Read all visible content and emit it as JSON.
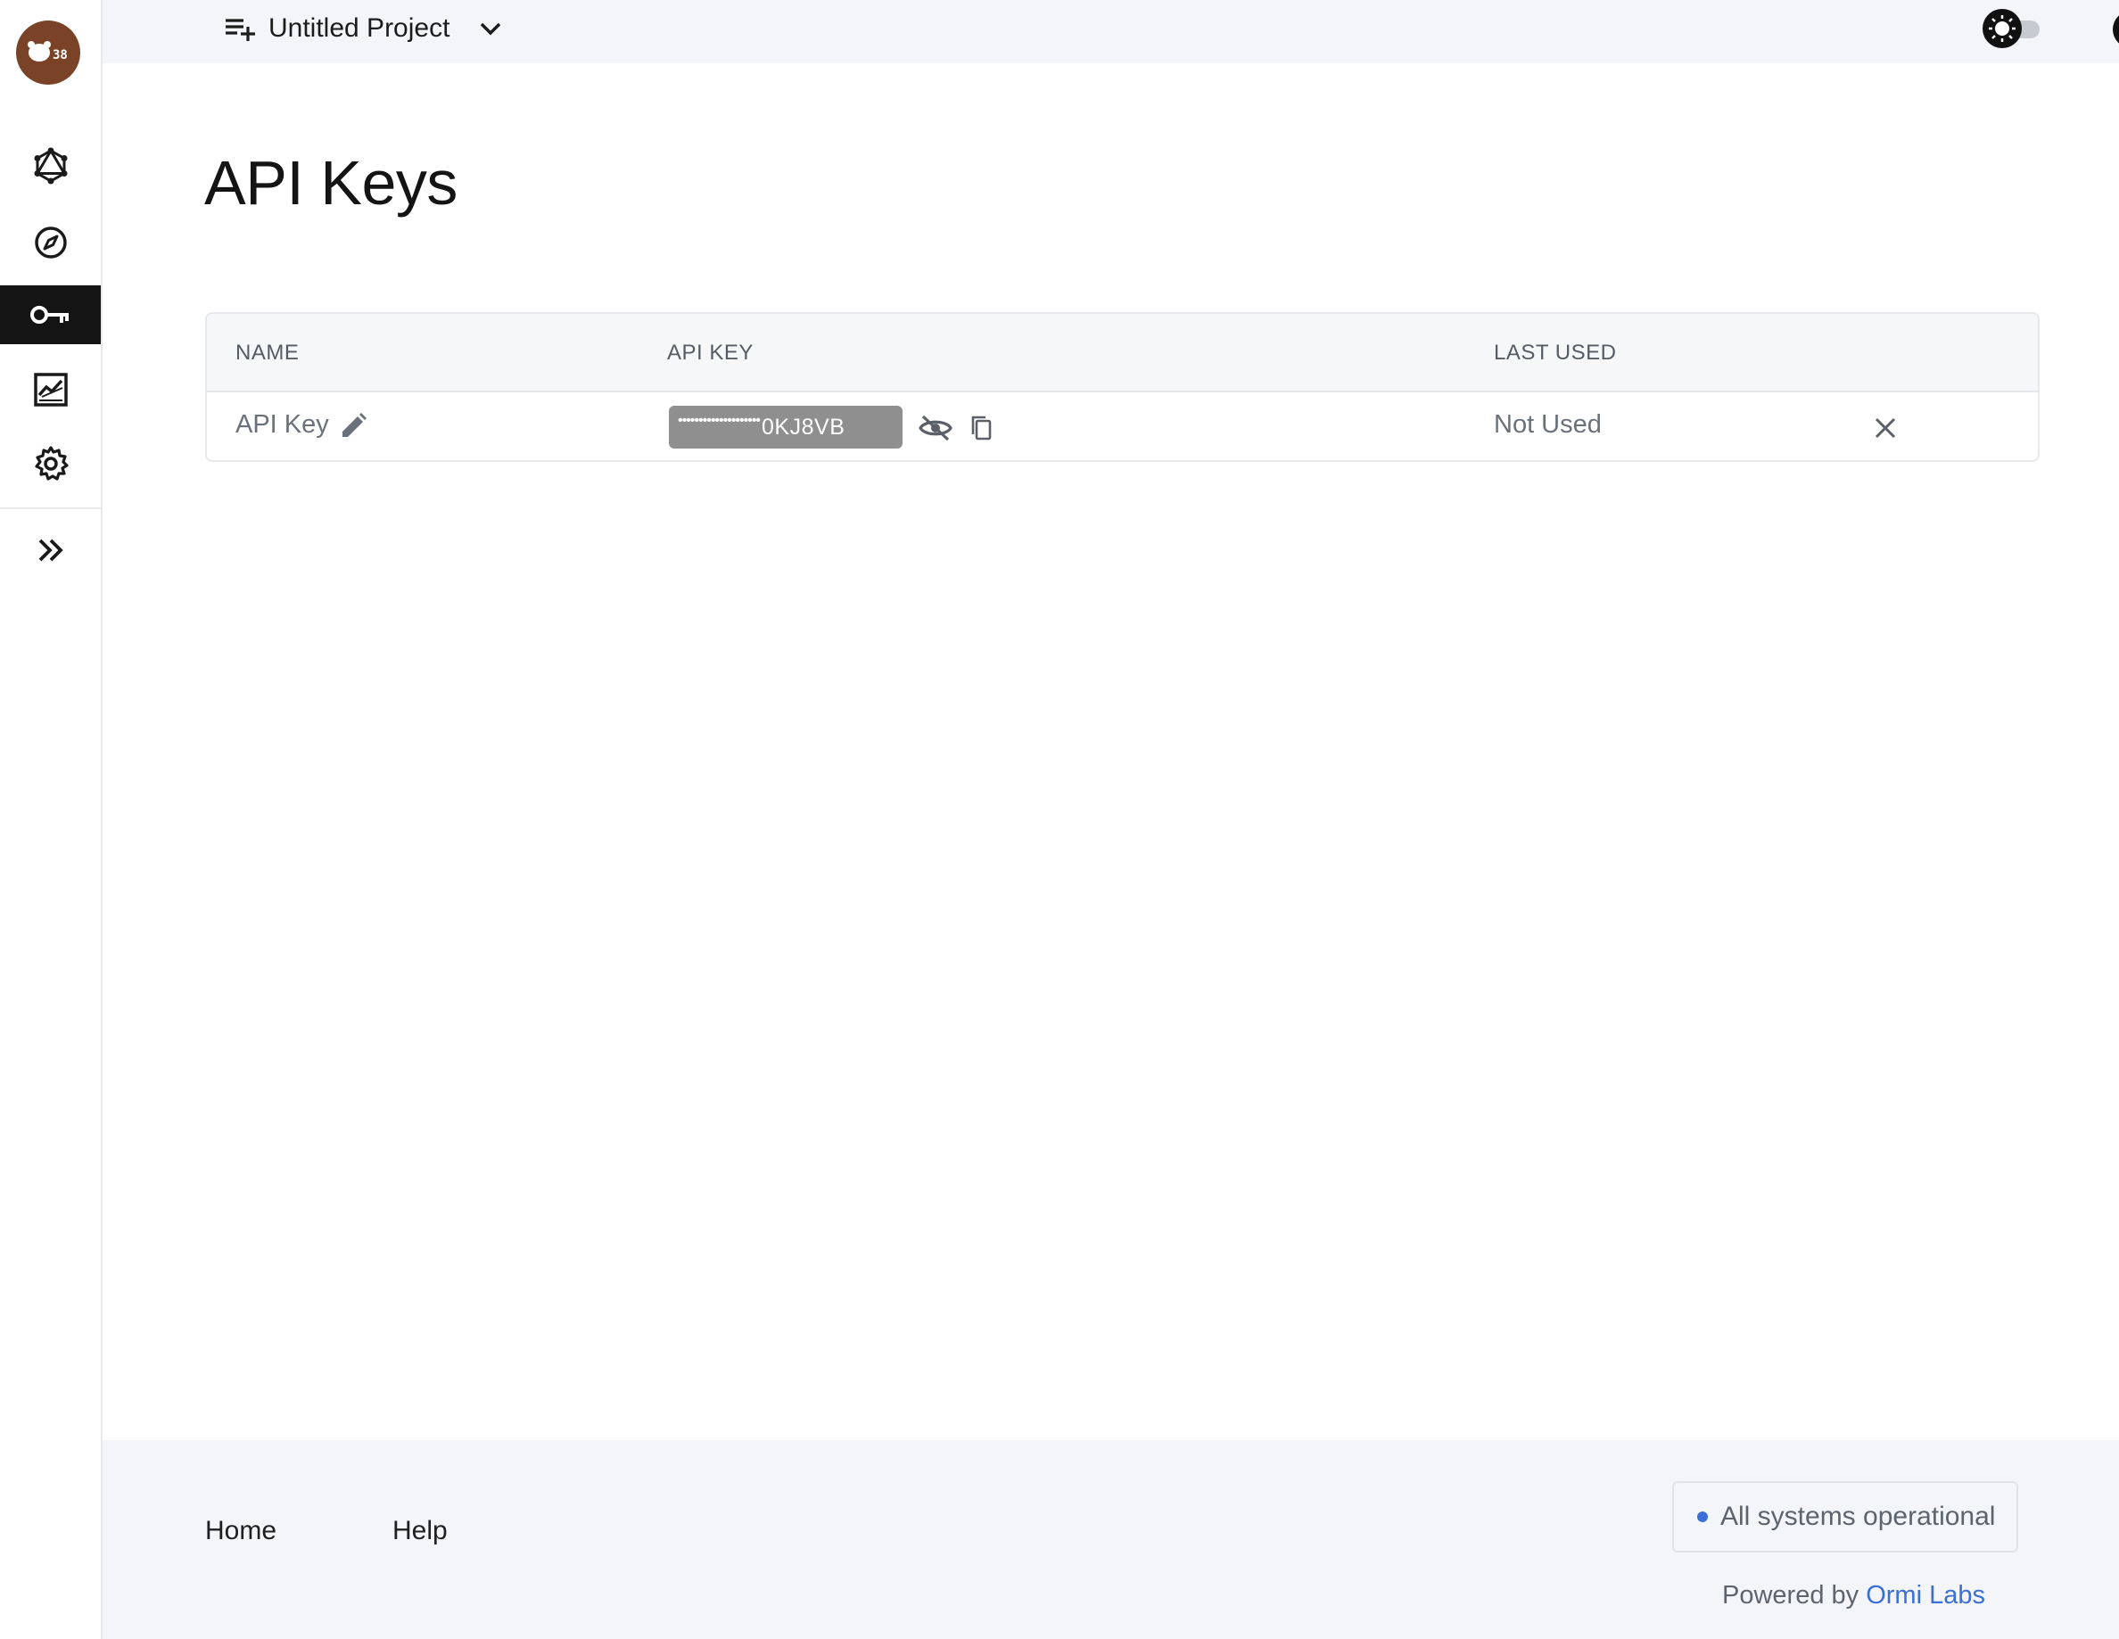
{
  "app": {
    "project_name": "Untitled Project",
    "logo_icon": "bear-logo-icon"
  },
  "sidebar": {
    "items": [
      {
        "name": "graphql",
        "icon": "graphql-icon",
        "active": false
      },
      {
        "name": "explorer",
        "icon": "compass-icon",
        "active": false
      },
      {
        "name": "api-keys",
        "icon": "key-icon",
        "active": true
      },
      {
        "name": "analytics",
        "icon": "chart-icon",
        "active": false
      },
      {
        "name": "settings",
        "icon": "gear-icon",
        "active": false
      }
    ],
    "expand_icon": "double-chevron-right-icon"
  },
  "header": {
    "theme_toggle_icon": "sun-icon",
    "account_icon": "account-circle-icon"
  },
  "main": {
    "title": "API Keys",
    "table": {
      "columns": [
        "NAME",
        "API KEY",
        "LAST USED"
      ],
      "rows": [
        {
          "name": "API Key",
          "key_mask": "••••••••••••••••••••",
          "key_suffix": "0KJ8VB",
          "last_used": "Not Used"
        }
      ]
    }
  },
  "footer": {
    "links": [
      "Home",
      "Help"
    ],
    "status_text": "All systems operational",
    "status_color": "#3b6fd6",
    "powered_prefix": "Powered by",
    "powered_link": "Ormi Labs"
  },
  "colors": {
    "accent": "#3b6fd6",
    "logo_bg": "#7a4327",
    "sidebar_active": "#141414",
    "key_chip": "#8f8f8f"
  }
}
